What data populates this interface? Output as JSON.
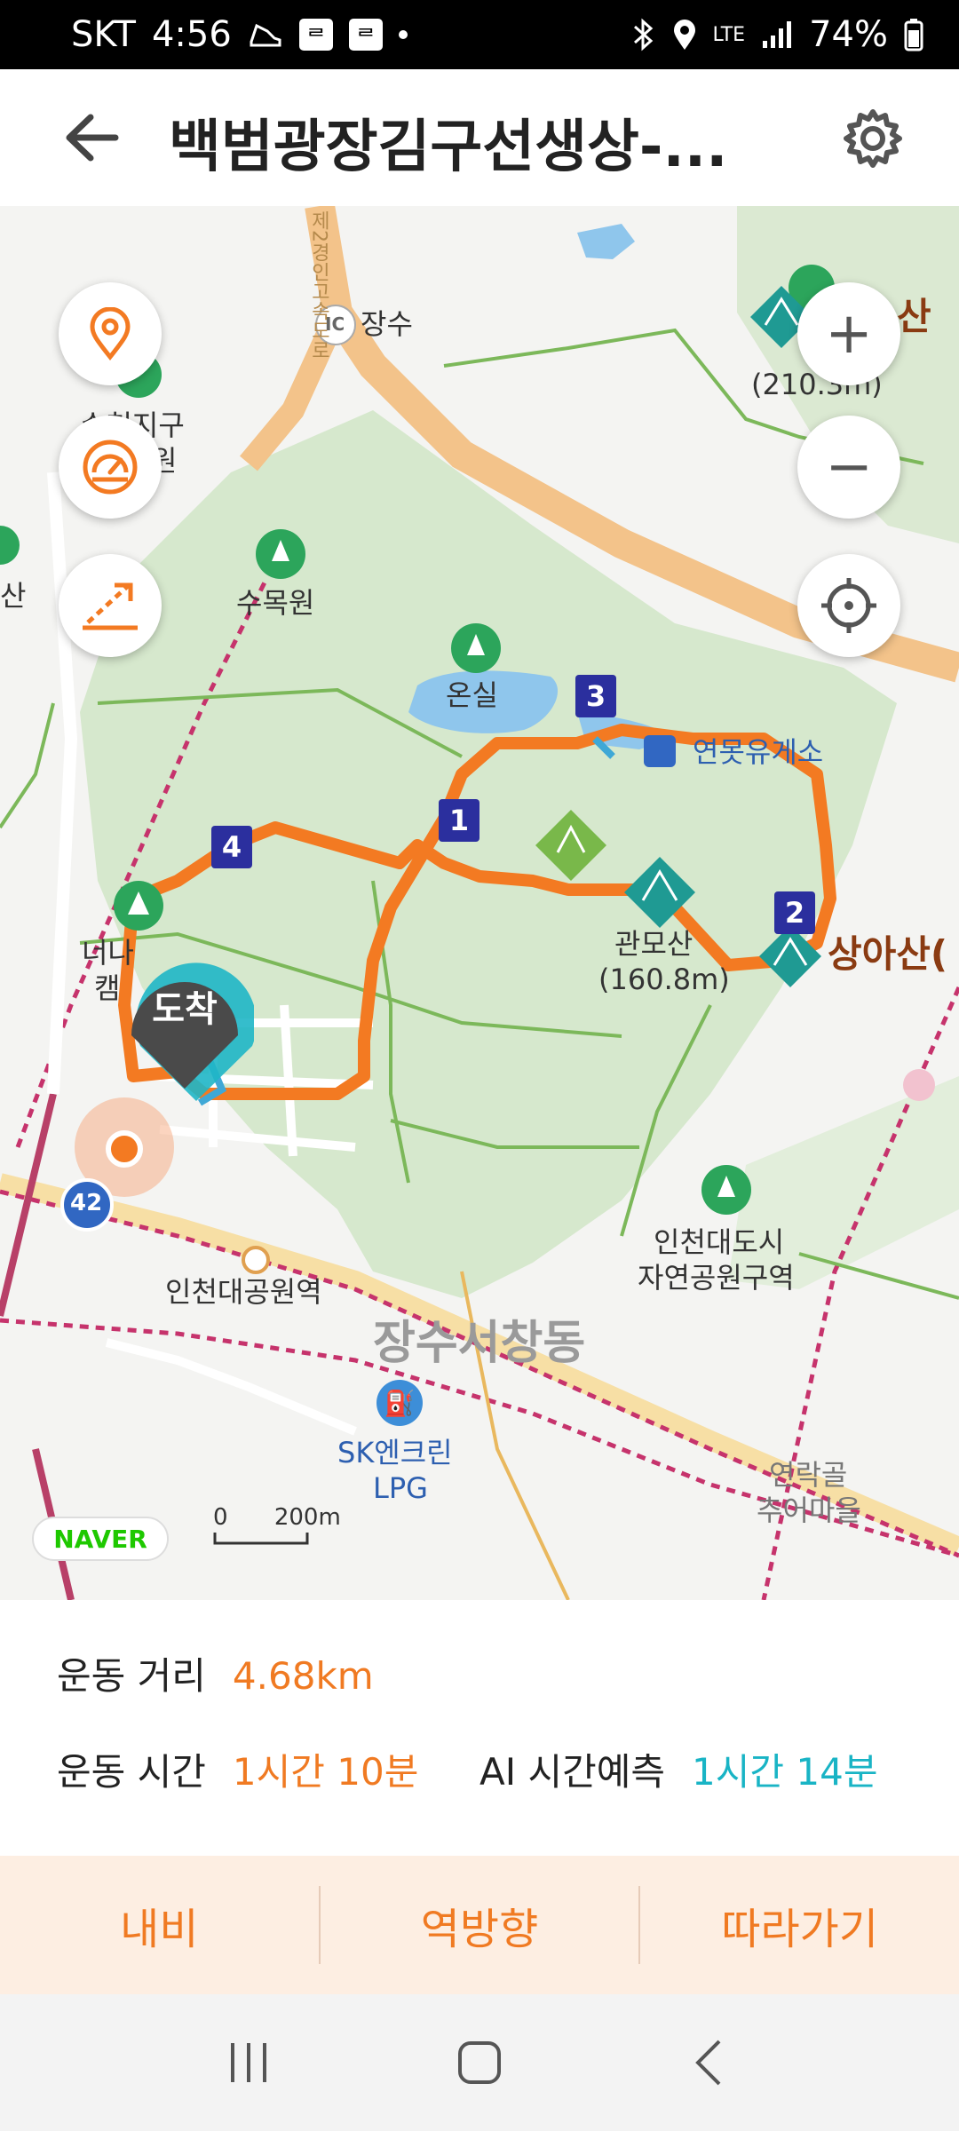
{
  "status_bar": {
    "carrier": "SKT",
    "time": "4:56",
    "network": "LTE",
    "battery": "74%",
    "notif_glyph_1": "ᄅ",
    "notif_glyph_2": "ᄅ"
  },
  "header": {
    "title": "백범광장김구선생상-...",
    "back_icon": "arrow-left-icon",
    "settings_icon": "gear-icon"
  },
  "map": {
    "labels": {
      "ic_badge": "IC",
      "jangsu": "장수",
      "sumokwon": "수목원",
      "onsil": "온실",
      "rest_area": "연못유게소",
      "gwanmosan": "관모산",
      "gwanmosan_height": "(160.8m)",
      "sangasan": "상아산(",
      "peak_height": "(210.3m)",
      "peak_name": "산",
      "north_district_1": "수천지구",
      "north_district_2": "원",
      "left_san": "산",
      "neoni_1": "너나",
      "neoni_2": "캠",
      "park_station": "인천대공원역",
      "jangsu_seochang": "장수서창동",
      "sk_station_1": "SK엔크린",
      "sk_station_2": "LPG",
      "incheon_park_1": "인천대도시",
      "incheon_park_2": "자연공원구역",
      "yeonrakgol_1": "연락골",
      "yeonrakgol_2": "추어마을",
      "road_sign": "42",
      "road_name": "제2경인고속도로",
      "arrive_label": "도착",
      "naver": "NAVER",
      "scale_zero": "0",
      "scale_value": "200m"
    },
    "waypoints": [
      "1",
      "2",
      "3",
      "4"
    ],
    "controls": {
      "zoom_in": "+",
      "zoom_out": "−"
    },
    "colors": {
      "route": "#f37a22",
      "park": "#d9ead0",
      "road": "#f6c88c",
      "waypoint": "#2b2f9e",
      "mountain_marker": "#1f9a93"
    }
  },
  "info": {
    "distance_label": "운동 거리",
    "distance_value": "4.68km",
    "time_label": "운동 시간",
    "time_value": "1시간 10분",
    "ai_label": "AI 시간예측",
    "ai_value": "1시간 14분"
  },
  "actions": {
    "nav": "내비",
    "reverse": "역방향",
    "follow": "따라가기"
  }
}
